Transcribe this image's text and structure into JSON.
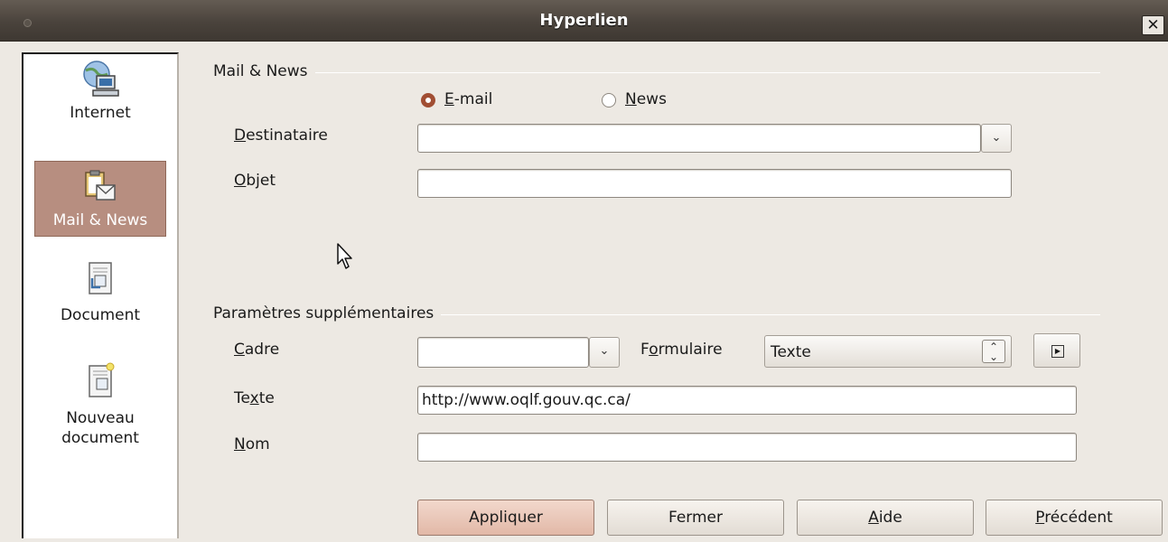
{
  "window": {
    "title": "Hyperlien",
    "close_glyph": "✕"
  },
  "sidebar": {
    "items": [
      {
        "label": "Internet",
        "icon": "globe-computer-icon"
      },
      {
        "label": "Mail & News",
        "icon": "mail-clipboard-icon"
      },
      {
        "label": "Document",
        "icon": "document-icon"
      },
      {
        "label": "Nouveau document",
        "label_line1": "Nouveau",
        "label_line2": "document",
        "icon": "new-document-icon"
      }
    ],
    "selected": "Mail & News"
  },
  "mail_news": {
    "section_title": "Mail & News",
    "radio_email": {
      "label_underlined": "E",
      "label_rest": "-mail",
      "selected": true
    },
    "radio_news": {
      "label_underlined": "N",
      "label_rest": "ews",
      "selected": false
    },
    "destinataire": {
      "label_underlined": "D",
      "label_rest": "estinataire",
      "value": ""
    },
    "objet": {
      "label_underlined": "O",
      "label_rest": "bjet",
      "value": ""
    }
  },
  "extra": {
    "section_title": "Paramètres supplémentaires",
    "cadre": {
      "label_underlined": "C",
      "label_rest": "adre",
      "value": ""
    },
    "formulaire": {
      "label_pre": "F",
      "label_underlined": "o",
      "label_rest": "rmulaire",
      "value": "Texte"
    },
    "texte": {
      "label_pre": "Te",
      "label_underlined": "x",
      "label_rest": "te",
      "value": "http://www.oqlf.gouv.qc.ca/"
    },
    "nom": {
      "label_underlined": "N",
      "label_rest": "om",
      "value": ""
    }
  },
  "buttons": {
    "apply": "Appliquer",
    "close": "Fermer",
    "help_underlined": "A",
    "help_rest": "ide",
    "previous_underlined": "P",
    "previous_rest": "récédent"
  },
  "colors": {
    "selected_bg": "#b78e80",
    "radio_accent": "#a14e33",
    "default_button": "#e2b8a7",
    "titlebar": "#4a433c"
  }
}
